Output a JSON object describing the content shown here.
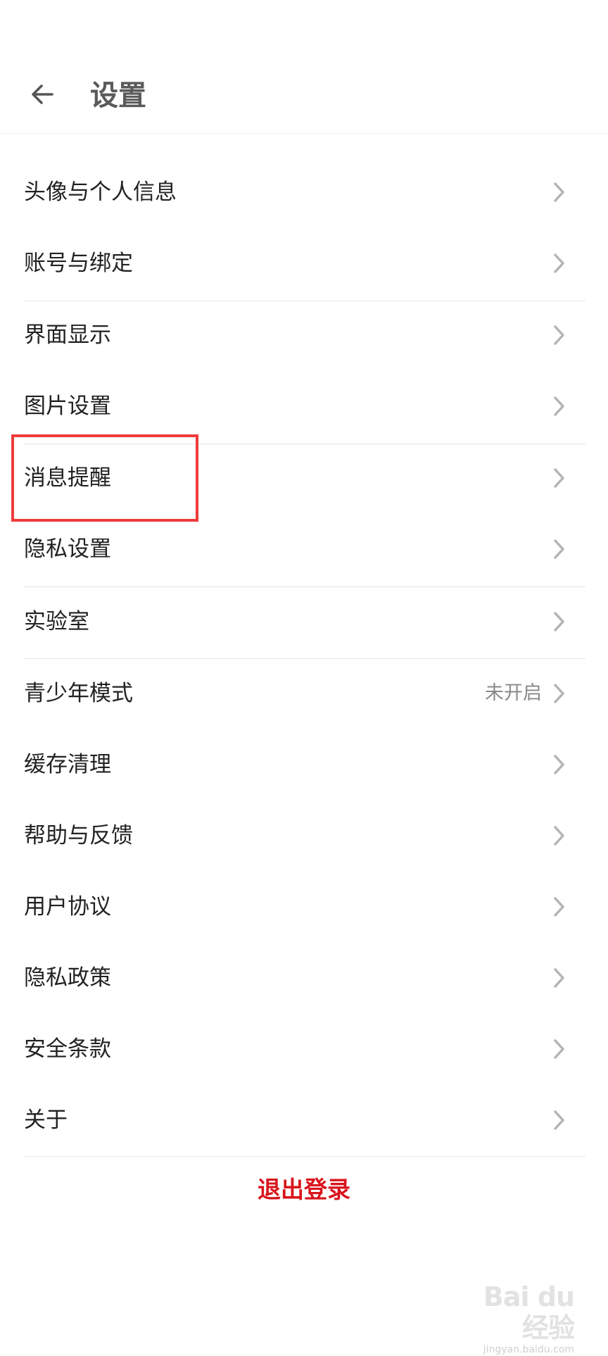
{
  "header": {
    "title": "设置",
    "back_icon": "arrow-left-icon"
  },
  "menu": {
    "items": [
      {
        "label": "头像与个人信息",
        "value": ""
      },
      {
        "label": "账号与绑定",
        "value": ""
      },
      {
        "label": "界面显示",
        "value": ""
      },
      {
        "label": "图片设置",
        "value": ""
      },
      {
        "label": "消息提醒",
        "value": ""
      },
      {
        "label": "隐私设置",
        "value": ""
      },
      {
        "label": "实验室",
        "value": ""
      },
      {
        "label": "青少年模式",
        "value": "未开启"
      },
      {
        "label": "缓存清理",
        "value": ""
      },
      {
        "label": "帮助与反馈",
        "value": ""
      },
      {
        "label": "用户协议",
        "value": ""
      },
      {
        "label": "隐私政策",
        "value": ""
      },
      {
        "label": "安全条款",
        "value": ""
      },
      {
        "label": "关于",
        "value": ""
      }
    ],
    "chevron_icon": "chevron-right-icon"
  },
  "logout": {
    "label": "退出登录"
  },
  "watermark": {
    "main": "Bai du 经验",
    "sub": "jingyan.baidu.com"
  },
  "colors": {
    "background": "#ffffff",
    "text": "#222222",
    "secondary_text": "#8a8a8a",
    "chevron": "#b4b4b4",
    "divider": "#e6e6e6",
    "logout_red": "#d9141c",
    "highlight_red": "#ee3b3b"
  }
}
